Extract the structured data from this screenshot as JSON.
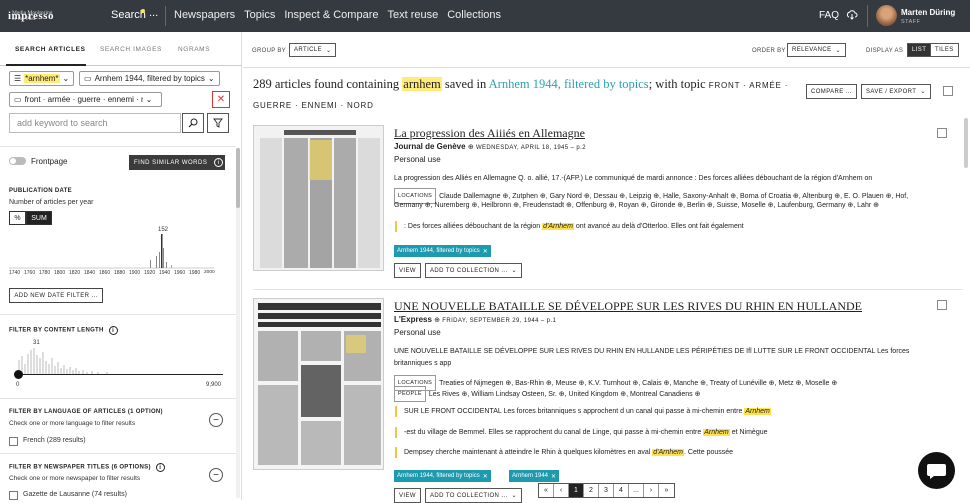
{
  "topbar": {
    "logo_big": "impresso",
    "logo_small1": "Media Monitoring",
    "logo_small2": "of the Past",
    "search": "Search",
    "more": "...",
    "nav": [
      "Newspapers",
      "Topics",
      "Inspect & Compare",
      "Text reuse",
      "Collections"
    ],
    "faq": "FAQ",
    "user_name": "Marten Düring",
    "user_role": "STAFF"
  },
  "sidebar": {
    "tabs": [
      "SEARCH ARTICLES",
      "SEARCH IMAGES",
      "NGRAMS"
    ],
    "chip_keyword": "*arnhem*",
    "chip_collection": "Arnhem 1944, filtered by topics",
    "chip_topics": "front · armée · guerre · ennemi · n",
    "kw_placeholder": "add keyword to search",
    "frontpage": "Frontpage",
    "find_similar": "FIND SIMILAR WORDS",
    "pubdate_title": "PUBLICATION DATE",
    "pubdate_sub": "Number of articles per year",
    "seg_pct": "%",
    "seg_sum": "SUM",
    "peak_label": "152",
    "timeline_ticks": [
      "1740",
      "1760",
      "1780",
      "1800",
      "1820",
      "1840",
      "1860",
      "1880",
      "1900",
      "1920",
      "1940",
      "1960",
      "1980",
      "2000"
    ],
    "add_date_filter": "ADD NEW DATE FILTER ...",
    "content_length_title": "FILTER BY CONTENT LENGTH",
    "content_peak": "31",
    "range_min": "0",
    "range_max": "9,900",
    "lang_title": "FILTER BY LANGUAGE OF ARTICLES (1 OPTION)",
    "lang_sub": "Check one or more language to filter results",
    "lang_option": "French (289 results)",
    "news_title": "FILTER BY NEWSPAPER TITLES (6 OPTIONS)",
    "news_sub": "Check one or more newspaper to filter results",
    "news_option": "Gazette de Lausanne (74 results)"
  },
  "toolbar": {
    "group_by": "GROUP BY",
    "group_value": "ARTICLE",
    "order_by": "ORDER BY",
    "order_value": "RELEVANCE",
    "display_as": "DISPLAY AS",
    "list": "LIST",
    "tiles": "TILES"
  },
  "summary": {
    "count_text": "289 articles found containing",
    "keyword": "arnhem",
    "saved_in": "saved in",
    "collection": "Arnhem 1944, filtered by topics",
    "topic_text": "; with topic",
    "topic_words_1": "FRONT · ARMÉE ·",
    "topic_words_2": "GUERRE · ENNEMI · NORD",
    "compare": "COMPARE ...",
    "save_export": "SAVE / EXPORT"
  },
  "articles": [
    {
      "title": "La progression des Aiiiés en Allemagne",
      "paper": "Journal de Genève",
      "date": "WEDNESDAY, APRIL 18, 1945 – p.2",
      "type": "Personal use",
      "snippet": "La progression des Alliés en Allemagne Q. o. allié, 17.-(AFP.) Le communiqué de mardi annonce : Des forces alliées débouchant de la région d'Arnhem on",
      "locations_label": "LOCATIONS",
      "locations_1": "Claude Dallemagne ⊕, Zutphen ⊕, Gary Nord ⊕, Dessau ⊕, Leipzig ⊕, Halle, Saxony-Anhalt ⊕, Borna of Croatia ⊕, Altenburg ⊕, E. O. Plauen ⊕, Hof,",
      "locations_2": "Germany ⊕, Nuremberg ⊕, Heilbronn ⊕, Freudenstadt ⊕, Offenburg ⊕, Royan ⊕, Gironde ⊕, Berlin ⊕, Suisse, Moselle ⊕, Laufenburg, Germany ⊕, Lahr ⊕",
      "quote_pre": ": Des forces alliées débouchant de la région",
      "quote_mark": "d'Arnhem",
      "quote_post": "ont avancé au delà d'Otterloo. Elles ont fait également",
      "chip": "Arnhem 1944, filtered by topics",
      "view": "VIEW",
      "add_collection": "ADD TO COLLECTION ..."
    },
    {
      "title": "UNE NOUVELLE BATAILLE SE DÉVELOPPE SUR LES RIVES DU RHIN EN HULLANDE",
      "paper": "L'Express",
      "date": "FRIDAY, SEPTEMBER 29, 1944 – p.1",
      "type": "Personal use",
      "snippet_1": "UNE NOUVELLE BATAILLE SE DÉVELOPPE SUR LES RIVES DU RHIN EN HULLANDE LES PÉRIPÉTIES DE Ifl LUTTE SUR LE FRONT OCCIDENTAL Les forces",
      "snippet_2": "britanniques s app",
      "locations_label": "LOCATIONS",
      "locations": "Treaties of Nijmegen ⊕, Bas-Rhin ⊕, Meuse ⊕, K.V. Turnhout ⊕, Calais ⊕, Manche ⊕, Treaty of Lunéville ⊕, Metz ⊕, Moselle ⊕",
      "people_label": "PEOPLE",
      "people": "Les Rives ⊕, William Lindsay Osteen, Sr. ⊕, United Kingdom ⊕, Montreal Canadiens ⊕",
      "q1_pre": "SUR LE FRONT OCCIDENTAL Les forces britanniques s approchent d un canal qui passe à mi-chemin entre",
      "q1_mark": "Arnhem",
      "q2_pre": "-est du village de Bemmel. Elles se rapprochent du canal de Linge, qui passe à mi-chemin entre",
      "q2_mark": "Arnhem",
      "q2_post": "et Nimègue",
      "q3_pre": "Dempsey cherche maintenant à atteindre le Rhin à quelques kilomètres en aval",
      "q3_mark": "d'Arnhem",
      "q3_post": ". Cette poussée",
      "chip1": "Arnhem 1944, filtered by topics",
      "chip2": "Arnhem 1944",
      "view": "VIEW",
      "add_collection": "ADD TO COLLECTION ..."
    }
  ],
  "pager": [
    "«",
    "‹",
    "1",
    "2",
    "3",
    "4",
    "...",
    "›",
    "»"
  ],
  "colors": {
    "accent": "#2aa1b3",
    "highlight": "#ffe14d",
    "topbar": "#343a40"
  }
}
